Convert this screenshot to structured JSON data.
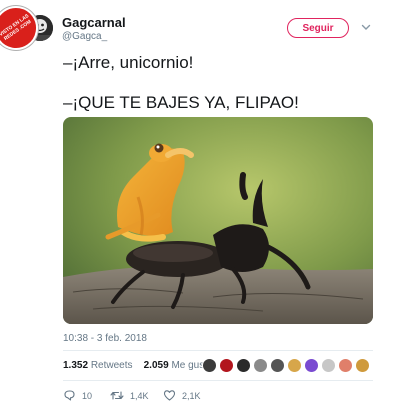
{
  "tweet": {
    "display_name": "Gagcarnal",
    "handle": "@Gagca_",
    "follow_label": "Seguir",
    "line1": "–¡Arre, unicornio!",
    "line2": "–¡QUE TE BAJES YA, FLIPAO!",
    "timestamp": "10:38 - 3 feb. 2018"
  },
  "stats": {
    "retweets_count": "1.352",
    "retweets_label": "Retweets",
    "likes_count": "2.059",
    "likes_label": "Me gusta"
  },
  "actions": {
    "replies": "10",
    "retweets": "1,4K",
    "likes": "2,1K"
  },
  "watermark": {
    "text": "VISTO EN LAS REDES .COM"
  },
  "colors": {
    "follow": "#e0245e",
    "muted": "#657786",
    "text": "#14171a"
  },
  "likers": [
    "#3b3b3b",
    "#b2151d",
    "#2a2a2a",
    "#8a8a8a",
    "#555555",
    "#d7a64a",
    "#7a4bd1",
    "#c7c7c7",
    "#e07f6a",
    "#cf9a3c"
  ]
}
